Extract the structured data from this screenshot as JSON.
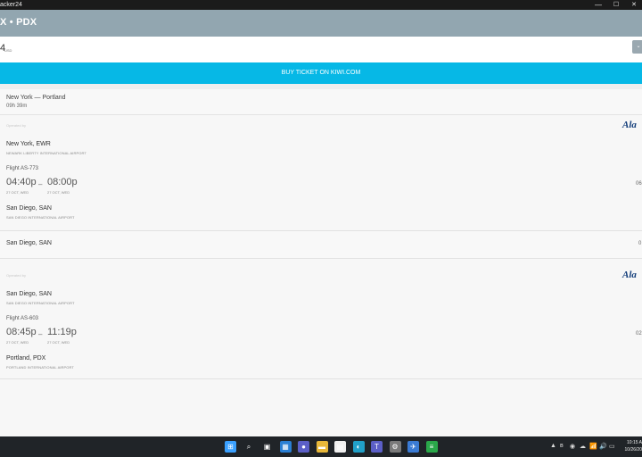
{
  "window": {
    "title": "acker24",
    "minimize_glyph": "—",
    "maximize_glyph": "☐",
    "close_glyph": "✕"
  },
  "header": {
    "route": "X • PDX"
  },
  "price": {
    "value": "4",
    "currency": "USD",
    "toggle_glyph": "⌄"
  },
  "buy": {
    "label": "BUY TICKET ON KIWI.COM"
  },
  "summary": {
    "cities": "New York — Portland",
    "duration": "09h 39m"
  },
  "segments": [
    {
      "operated_by": "Operated by",
      "airline_logo": "Ala",
      "from_place": "New York, EWR",
      "from_airport": "NEWARK LIBERTY INTERNATIONAL AIRPORT",
      "flight": "Flight AS-773",
      "dep_time": "04:40p",
      "dash": "–",
      "arr_time": "08:00p",
      "dep_date": "27 OCT, WED",
      "arr_date": "27 OCT, WED",
      "right_text": "06",
      "to_place": "San Diego, SAN",
      "to_airport": "SAN DIEGO INTERNATIONAL AIRPORT"
    },
    {
      "operated_by": "Operated by",
      "airline_logo": "Ala",
      "from_place": "San Diego, SAN",
      "from_airport": "SAN DIEGO INTERNATIONAL AIRPORT",
      "flight": "Flight AS-603",
      "dep_time": "08:45p",
      "dash": "–",
      "arr_time": "11:19p",
      "dep_date": "27 OCT, WED",
      "arr_date": "27 OCT, WED",
      "right_text": "02",
      "to_place": "Portland, PDX",
      "to_airport": "PORTLAND INTERNATIONAL AIRPORT"
    }
  ],
  "layover": {
    "city": "San Diego, SAN",
    "right_text": "0"
  },
  "taskbar": {
    "icons": [
      {
        "name": "start-icon",
        "glyph": "⊞",
        "color": "#3aa0ff"
      },
      {
        "name": "search-icon",
        "glyph": "⌕",
        "color": "#202428"
      },
      {
        "name": "task-view-icon",
        "glyph": "▣",
        "color": "#202428"
      },
      {
        "name": "widgets-icon",
        "glyph": "▦",
        "color": "#2a7fd4"
      },
      {
        "name": "chat-icon",
        "glyph": "●",
        "color": "#5b5fc7"
      },
      {
        "name": "file-explorer-icon",
        "glyph": "▬",
        "color": "#e8b83a"
      },
      {
        "name": "store-icon",
        "glyph": "▤",
        "color": "#f0f0f0"
      },
      {
        "name": "edge-icon",
        "glyph": "◐",
        "color": "#21a0c8"
      },
      {
        "name": "teams-icon",
        "glyph": "T",
        "color": "#5b5fc7"
      },
      {
        "name": "settings-icon",
        "glyph": "⚙",
        "color": "#7a7a7a"
      },
      {
        "name": "flight-tracker-icon",
        "glyph": "✈",
        "color": "#3a7bd5"
      },
      {
        "name": "app-icon",
        "glyph": "≡",
        "color": "#2aa84a"
      }
    ],
    "tray_glyphs": [
      "▲",
      "ʙ",
      "◉",
      "☁",
      "📶",
      "🔊",
      "▭"
    ],
    "time": "10:15 A",
    "date": "10/26/20"
  }
}
